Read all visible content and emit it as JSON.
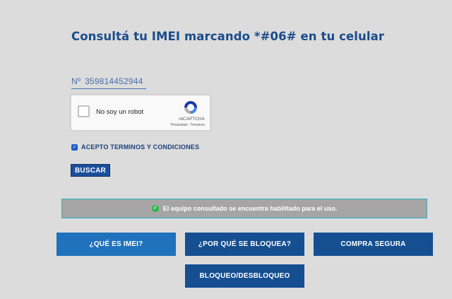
{
  "header": {
    "title": "Consultá tu IMEI marcando *#06# en tu celular"
  },
  "imei": {
    "prefix": "Nº",
    "value": "359814452944"
  },
  "captcha": {
    "label": "No soy un robot",
    "brand": "reCAPTCHA",
    "links": "Privacidad - Términos",
    "checked": false
  },
  "terms": {
    "label": "ACEPTO TERMINOS Y CONDICIONES",
    "checked": true
  },
  "search": {
    "button_label": "BUSCAR"
  },
  "result": {
    "message": "El equipo consultado se encuentra habilitado para el uso.",
    "status_color": "#2cb84a"
  },
  "nav": {
    "items": [
      {
        "label": "¿QUÉ ES IMEI?"
      },
      {
        "label": "¿POR QUÉ SE BLOQUEA?"
      },
      {
        "label": "COMPRA SEGURA"
      },
      {
        "label": "BLOQUEO/DESBLOQUEO"
      }
    ]
  },
  "colors": {
    "background": "#dcdcdc",
    "title": "#1a4c8b",
    "primary": "#154f92",
    "primary_light": "#1f72bb",
    "result_bg": "#a5a5a5",
    "result_border": "#2bb3c9"
  }
}
